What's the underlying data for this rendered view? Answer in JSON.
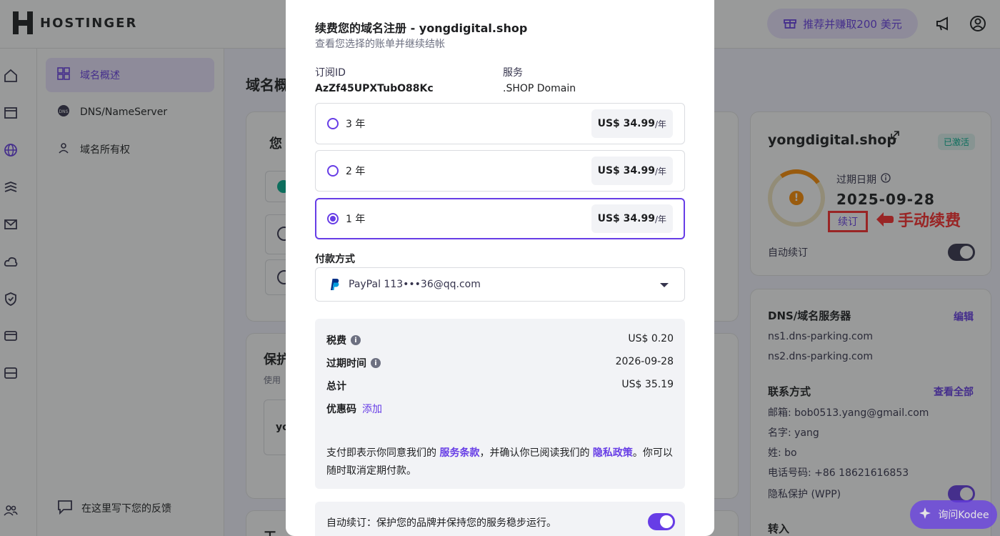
{
  "brand": {
    "name": "HOSTINGER"
  },
  "topbar": {
    "refer_label": "推荐并赚取200 美元"
  },
  "subnav": {
    "items": [
      {
        "label": "域名概述",
        "active": true
      },
      {
        "label": "DNS/NameServer",
        "active": false
      },
      {
        "label": "域名所有权",
        "active": false
      }
    ],
    "feedback_label": "在这里写下您的反馈"
  },
  "main": {
    "title": "域名概"
  },
  "domain_card": {
    "domain": "yongdigital.shop",
    "status_badge": "已激活",
    "expiry_label": "过期日期",
    "expiry_date": "2025-09-28",
    "renew_link": "续订",
    "annotation": "手动续费",
    "auto_renew_label": "自动续订",
    "auto_renew_on": false
  },
  "dns_card": {
    "title": "DNS/域名服务器",
    "edit_label": "编辑",
    "nameservers": [
      "ns1.dns-parking.com",
      "ns2.dns-parking.com"
    ],
    "contact_title": "联系方式",
    "view_all_label": "查看全部",
    "contact": {
      "email": "邮箱: bob0513.yang@gmail.com",
      "first_name": "名字: yang",
      "last_name": "姓: bo",
      "phone": "电话号码: +86 18621616853",
      "privacy": "隐私保护 (WPP)"
    },
    "transfer_label": "转入"
  },
  "modal": {
    "title": "续费您的域名注册 - yongdigital.shop",
    "subtitle": "查看您选择的账单并继续结帐",
    "subscription_id_label": "订阅ID",
    "subscription_id": "AzZf45UPXTubO88Kc",
    "service_label": "服务",
    "service": ".SHOP Domain",
    "options": [
      {
        "label": "3 年",
        "price": "US$ 34.99",
        "unit": "/年",
        "selected": false
      },
      {
        "label": "2 年",
        "price": "US$ 34.99",
        "unit": "/年",
        "selected": false
      },
      {
        "label": "1 年",
        "price": "US$ 34.99",
        "unit": "/年",
        "selected": true
      }
    ],
    "payment_label": "付款方式",
    "payment_method": "PayPal  113•••36@qq.com",
    "summary": {
      "tax_label": "税费",
      "tax": "US$ 0.20",
      "expiry_label": "过期时间",
      "expiry": "2026-09-28",
      "total_label": "总计",
      "total": "US$ 35.19",
      "coupon_label": "优惠码",
      "coupon_link": "添加",
      "terms_pre": "支付即表示你同意我们的 ",
      "terms_link": "服务条款",
      "terms_mid": "，并确认你已阅读我们的 ",
      "privacy_link": "隐私政策",
      "terms_post": "。你可以随时取消定期付款。"
    },
    "auto_renew_text": "自动续订：保护您的品牌并保持您的服务稳步运行。",
    "auto_renew_on": true
  },
  "kodee": {
    "label": "询问Kodee"
  }
}
